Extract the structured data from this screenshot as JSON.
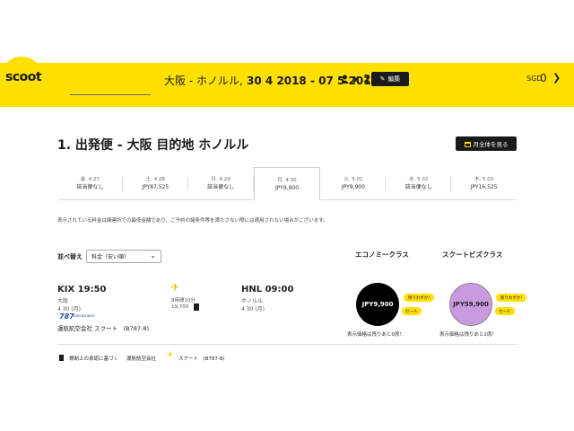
{
  "header": {
    "logo": "scoot",
    "trip_from": "大阪 - ",
    "trip_to": "ホノルル,",
    "trip_dates": " 30 4 2018 - 07 5 2018",
    "pax": "x 2",
    "edit_label": "編集",
    "currency": "SGD",
    "currency_value": "0",
    "brand_color": "#ffe000"
  },
  "main": {
    "title": "1. 出発便 - 大阪 目的地 ホノルル",
    "month_button": "月全体を見る",
    "dates": [
      {
        "label": "金. 4.27",
        "price": "該当便なし"
      },
      {
        "label": "土. 4.28",
        "price": "JPY87,525"
      },
      {
        "label": "日. 4.29",
        "price": "該当便なし"
      },
      {
        "label": "月. 4.30",
        "price": "JPY9,900"
      },
      {
        "label": "火. 5.01",
        "price": "JPY9,900"
      },
      {
        "label": "水. 5.02",
        "price": "該当便なし"
      },
      {
        "label": "木. 5.03",
        "price": "JPY16,525"
      }
    ],
    "note": "表示されている料金は関連所での最低金額であり、ご予約の諸条件等を満たさない際には適用されない場合がございます。",
    "sort_label": "並べ替え",
    "sort_value": "料金（安い順）",
    "class_economy": "エコノミークラス",
    "class_business": "スクートビズクラス"
  },
  "flight": {
    "dep_time": "KIX 19:50",
    "dep_city": "大阪",
    "dep_date": "4 30 (月)",
    "aircraft_code": "787",
    "aircraft_brand": "DREAMLINER",
    "operator": "運航航空会社 スクート　(B787-8)",
    "duration": "8時間10分",
    "points": "19,700",
    "arr_time": "HNL 09:00",
    "arr_city": "ホノルル",
    "arr_date": "4 30 (月)",
    "economy_price": "JPY9,900",
    "business_price": "JPY59,900",
    "remaining_tag": "残りわずか!",
    "sale_tag": "セール",
    "economy_seats": "表示価格は残りあと0席！",
    "business_seats": "表示価格は残りあと2席！"
  },
  "legend": {
    "item1": "規制上の承認に基づく",
    "item2": "運航航空会社",
    "item3": "スクート　(B787-8)"
  },
  "icons": {
    "user": "user-icon",
    "edit": "pencil-icon",
    "calendar": "calendar-icon",
    "plane": "plane-icon",
    "chevron": "chevron-down-icon"
  }
}
